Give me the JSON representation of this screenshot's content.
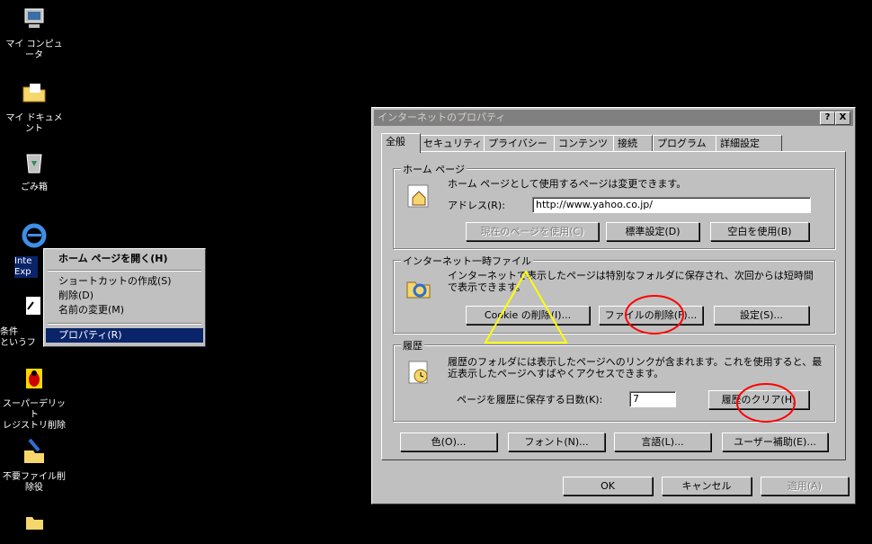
{
  "desktop": {
    "icons": [
      {
        "label": "マイ コンピュータ",
        "icon": "computer-icon"
      },
      {
        "label": "マイ ドキュメント",
        "icon": "folder-documents-icon"
      },
      {
        "label": "ごみ箱",
        "icon": "recycle-bin-icon"
      },
      {
        "label": "Inte\nExp",
        "icon": "internet-explorer-icon"
      },
      {
        "label": "条件\nというフ",
        "icon": "shortcut-icon"
      },
      {
        "label": "スーパーデリット\nレジストリ削除",
        "icon": "bug-icon"
      },
      {
        "label": "不要ファイル削\n除役",
        "icon": "cleanup-icon"
      },
      {
        "label": "",
        "icon": "folder-icon"
      }
    ]
  },
  "context_menu": {
    "items": [
      {
        "label": "ホーム ページを開く(H)",
        "bold": true,
        "selected": false
      },
      {
        "label": "ショートカットの作成(S)",
        "bold": false,
        "selected": false
      },
      {
        "label": "削除(D)",
        "bold": false,
        "selected": false
      },
      {
        "label": "名前の変更(M)",
        "bold": false,
        "selected": false
      },
      {
        "label": "プロパティ(R)",
        "bold": false,
        "selected": true
      }
    ]
  },
  "dialog": {
    "title": "インターネットのプロパティ",
    "help_button": "?",
    "close_button": "X",
    "tabs": [
      "全般",
      "セキュリティ",
      "プライバシー",
      "コンテンツ",
      "接続",
      "プログラム",
      "詳細設定"
    ],
    "home": {
      "title": "ホーム ページ",
      "description": "ホーム ページとして使用するページは変更できます。",
      "address_label": "アドレス(R):",
      "address_value": "http://www.yahoo.co.jp/",
      "use_current": "現在のページを使用(C)",
      "use_default": "標準設定(D)",
      "use_blank": "空白を使用(B)"
    },
    "temp_files": {
      "title": "インターネット一時ファイル",
      "description": "インターネットで表示したページは特別なフォルダに保存され、次回からは短時間で表示できます。",
      "cookies_button": "Cookie の削除(I)...",
      "files_button": "ファイルの削除(F)...",
      "settings_button": "設定(S)..."
    },
    "history": {
      "title": "履歴",
      "description": "履歴のフォルダには表示したページへのリンクが含まれます。これを使用すると、最近表示したページへすばやくアクセスできます。",
      "days_label": "ページを履歴に保存する日数(K):",
      "days_value": "7",
      "clear_button": "履歴のクリア(H)"
    },
    "bottom_buttons": {
      "colors": "色(O)...",
      "fonts": "フォント(N)...",
      "languages": "言語(L)...",
      "accessibility": "ユーザー補助(E)..."
    },
    "footer": {
      "ok": "OK",
      "cancel": "キャンセル",
      "apply": "適用(A)"
    }
  },
  "annotations": {
    "circle_color": "#ff0000",
    "triangle_color": "#ffff00"
  },
  "colors": {
    "selection": "#0a246a",
    "face": "#c0c0c0"
  }
}
